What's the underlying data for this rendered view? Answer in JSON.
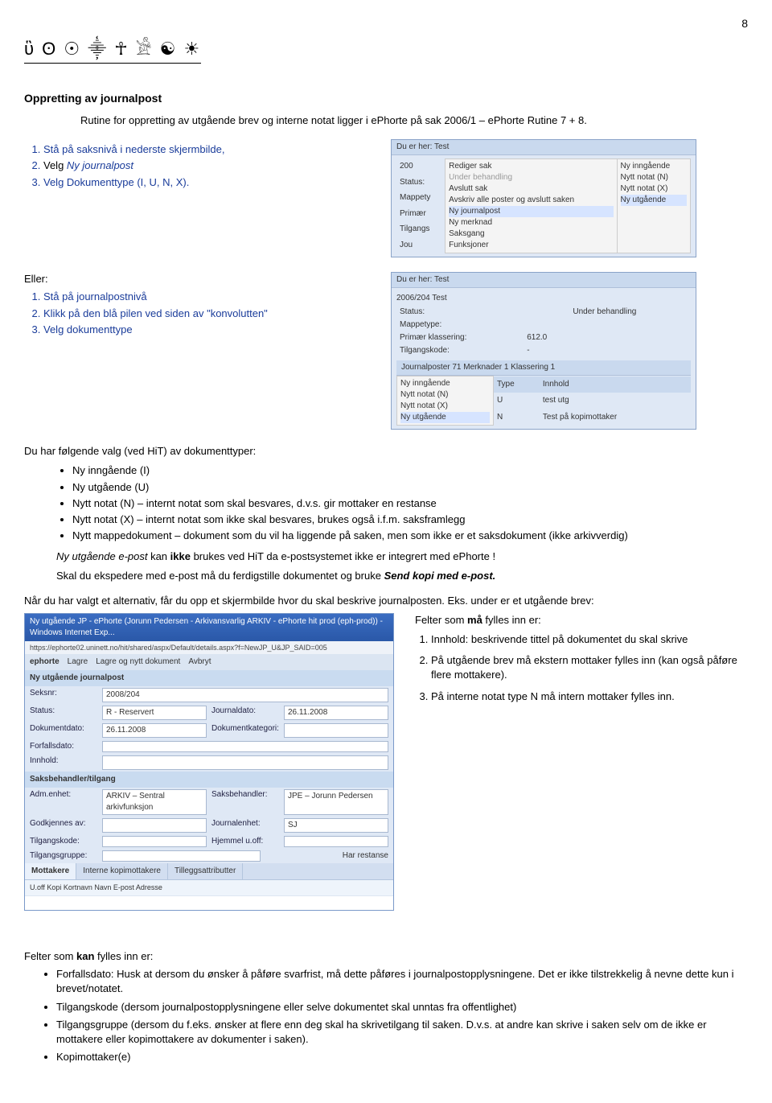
{
  "page_number": "8",
  "logo_glyphs": "ὓ ʘ ☉ ⸎ ☥ 𓀀 ☯ ☀",
  "h_main": "Oppretting av journalpost",
  "intro": "Rutine for oppretting av utgående brev og interne notat ligger i ePhorte på sak 2006/1 – ePhorte Rutine 7 + 8.",
  "list1_intro": "",
  "list1": [
    "Stå på saksnivå i nederste skjermbilde,",
    "Velg Ny journalpost",
    "Velg Dokumenttype (I, U, N, X)."
  ],
  "list1_italic_word": "Ny journalpost",
  "eller_label": "Eller:",
  "list2": [
    "Stå på journalpostnivå",
    "Klikk på den blå pilen ved siden av \"konvolutten\"",
    "Velg dokumenttype"
  ],
  "shotA": {
    "breadcrumb": "Du er her:    Test",
    "folder": "200",
    "status": "Status:",
    "mappety": "Mappety",
    "primaer": "Primær",
    "tilgangs": "Tilgangs",
    "jou": "Jou",
    "menu_left": [
      "Rediger sak",
      "Under behandling",
      "Avslutt sak",
      "Avskriv alle poster og avslutt saken",
      "Ny journalpost",
      "Ny merknad",
      "Saksgang",
      "Funksjoner"
    ],
    "menu_right": [
      "Ny inngående",
      "Nytt notat (N)",
      "Nytt notat (X)",
      "Ny utgående"
    ]
  },
  "shotB": {
    "breadcrumb": "Du er her:    Test",
    "folder": "2006/204  Test",
    "rows": [
      [
        "Status:",
        "",
        "Under behandling"
      ],
      [
        "Mappetype:",
        "",
        ""
      ],
      [
        "Primær klassering:",
        "612.0",
        ""
      ],
      [
        "Tilgangskode:",
        "-",
        ""
      ]
    ],
    "tabs": "Journalposter  71     Merknader  1    Klassering  1",
    "menu_left": [
      "Ny inngående",
      "Nytt notat (N)",
      "Nytt notat (X)",
      "Ny utgående"
    ],
    "cols": [
      "Type",
      "Innhold"
    ],
    "vals": [
      [
        "U",
        "test utg"
      ],
      [
        "N",
        "Test på kopimottaker"
      ]
    ]
  },
  "p_doctypes_intro": "Du har følgende valg (ved HiT) av dokumenttyper:",
  "doctypes": [
    "Ny inngående (I)",
    "Ny utgående (U)",
    "Nytt notat (N) – internt notat som skal besvares, d.v.s. gir mottaker en restanse",
    "Nytt notat (X) – internt notat som ikke skal besvares, brukes også i.f.m. saksframlegg",
    "Nytt mappedokument – dokument som du vil ha liggende på saken, men som ikke er et saksdokument (ikke arkivverdig)"
  ],
  "epost_line1_a": "Ny utgående e-post",
  "epost_line1_b": " kan ",
  "epost_line1_c": "ikke",
  "epost_line1_d": " brukes ved HiT da e-postsystemet ikke er integrert med ePhorte !",
  "epost_line2_a": "Skal du ekspedere med e-post må du ferdigstille dokumentet og bruke ",
  "epost_line2_b": "Send kopi med e-post.",
  "p_after_choice": "Når du har valgt et alternativ, får du opp et skjermbilde hvor du skal beskrive journalposten. Eks. under er et utgående brev:",
  "shotC": {
    "title": "Ny utgående JP - ePhorte (Jorunn Pedersen - Arkivansvarlig ARKIV - ePhorte hit prod (eph-prod)) - Windows Internet Exp...",
    "addr": "https://ephorte02.uninett.no/hit/shared/aspx/Default/details.aspx?f=NewJP_U&JP_SAID=005",
    "ephorte_label": "ephorte",
    "btn_lagre": "Lagre",
    "btn_lagre_nytt": "Lagre og nytt dokument",
    "btn_avbryt": "Avbryt",
    "header": "Ny utgående journalpost",
    "lbl_seksnr": "Seksnr:",
    "val_seksnr": "2008/204",
    "lbl_status": "Status:",
    "val_status": "R - Reservert",
    "lbl_jdate": "Journaldato:",
    "val_jdate": "26.11.2008",
    "lbl_dokdate": "Dokumentdato:",
    "val_dokdate": "26.11.2008",
    "lbl_dokkat": "Dokumentkategori:",
    "lbl_forfall": "Forfallsdato:",
    "lbl_innhold": "Innhold:",
    "sec2": "Saksbehandler/tilgang",
    "lbl_admenhet": "Adm.enhet:",
    "val_admenhet": "ARKIV – Sentral arkivfunksjon",
    "lbl_saksbeh": "Saksbehandler:",
    "val_saksbeh": "JPE – Jorunn Pedersen",
    "lbl_godkj": "Godkjennes av:",
    "lbl_journalenhet": "Journalenhet:",
    "val_journalenhet": "SJ",
    "lbl_tilgangskode": "Tilgangskode:",
    "lbl_hjemmel": "Hjemmel u.off:",
    "lbl_tilgangsgruppe": "Tilgangsgruppe:",
    "chk_restanse": "Har restanse",
    "tabs": [
      "Mottakere",
      "Interne kopimottakere",
      "Tilleggsattributter"
    ],
    "cols": "U.off  Kopi  Kortnavn    Navn                E-post              Adresse"
  },
  "fields_must_intro": "Felter som må fylles inn er:",
  "must_word": "må",
  "fields_must": [
    "Innhold: beskrivende tittel på dokumentet du skal skrive",
    "På utgående brev må ekstern mottaker fylles inn (kan også påføre flere mottakere).",
    "På interne notat type N må intern mottaker fylles inn."
  ],
  "fields_can_intro_a": "Felter som ",
  "fields_can_intro_b": "kan",
  "fields_can_intro_c": " fylles inn er:",
  "fields_can": [
    "Forfallsdato: Husk at dersom du ønsker å påføre svarfrist, må dette påføres i journalpostopplysningene. Det er ikke tilstrekkelig å nevne dette kun i brevet/notatet.",
    "Tilgangskode (dersom journalpostopplysningene eller selve dokumentet skal unntas fra offentlighet)",
    "Tilgangsgruppe (dersom du f.eks. ønsker at flere enn deg skal ha skrivetilgang til saken. D.v.s. at andre kan skrive i saken selv om de ikke er mottakere eller kopimottakere av dokumenter i saken).",
    "Kopimottaker(e)"
  ]
}
